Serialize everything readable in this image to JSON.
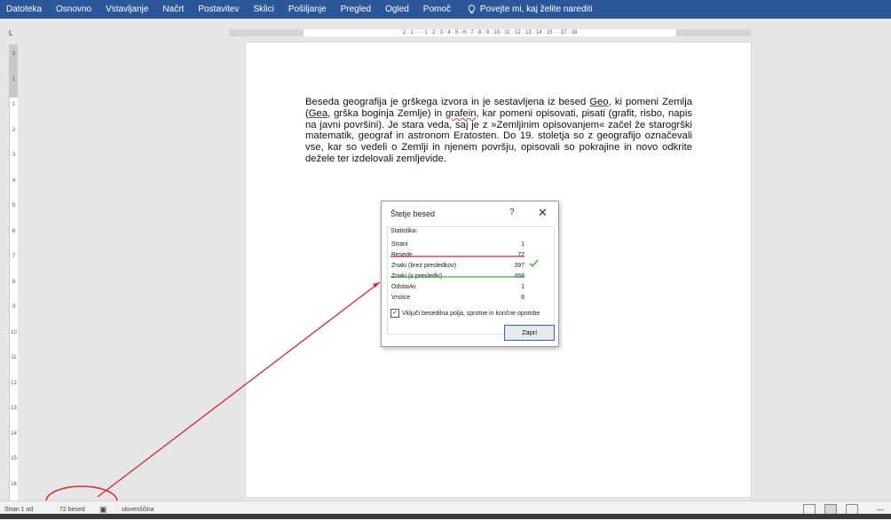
{
  "ribbon_tabs": [
    "Datoteka",
    "Osnovno",
    "Vstavljanje",
    "Načrt",
    "Postavitev",
    "Sklici",
    "Pošiljanje",
    "Pregled",
    "Ogled",
    "Pomoč"
  ],
  "tell_me": "Povejte mi, kaj želite narediti",
  "ruler": {
    "tab_selector": "L",
    "h_numbers": "2 · 1 · · · 1 · 2 · 3 · 4 · 5 · 6 · 7 · 8 · 9 · 10 · 11 · 12 · 13 · 14 · 15 · · 17 · 18",
    "v_numbers": [
      "2",
      "1",
      "1",
      "2",
      "3",
      "4",
      "5",
      "6",
      "7",
      "8",
      "9",
      "10",
      "11",
      "12",
      "13",
      "14",
      "15",
      "16"
    ]
  },
  "document": {
    "p1": "Beseda geografija je grškega izvora in je sestavljena iz besed ",
    "geo": "Geo",
    "p2": ", ki pomeni Zemlja (",
    "gea": "Gea",
    "p3": ", grška boginja Zemlje) in ",
    "grafein": "grafein",
    "p4": ", kar pomeni opisovati, pisati (grafit, risbo, napis na javni površini). Je stara veda, saj je z »Zemljinim opisovanjem« začel že starogrški matematik, geograf in astronom Eratosten. Do 19. stoletja so z geografijo označevali vse, kar so vedeli o Zemlji in njenem površju, opisovali so pokrajine in novo odkrite dežele ter izdelovali zemljevide."
  },
  "dialog": {
    "title": "Štetje besed",
    "help": "?",
    "close": "✕",
    "group_label": "Statistika:",
    "rows": [
      {
        "label": "Strani",
        "value": "1"
      },
      {
        "label": "Besede",
        "value": "72"
      },
      {
        "label": "Znaki (brez presledkov)",
        "value": "397"
      },
      {
        "label": "Znaki (s presledki)",
        "value": "468"
      },
      {
        "label": "Odstavki",
        "value": "1"
      },
      {
        "label": "Vrstice",
        "value": "6"
      }
    ],
    "checkbox_label": "Vključi besedilna polja, sprotne in končne opombe",
    "checkbox_checked": true,
    "close_button": "Zapri"
  },
  "status": {
    "page": "Stran 1 od",
    "words": "72 besed",
    "language": "slovenščina",
    "zoom": "—"
  },
  "colors": {
    "ribbon": "#2b579a",
    "annotation_red": "#d8262c",
    "check_green": "#3fae3f",
    "underline_green": "#3fae3f"
  }
}
